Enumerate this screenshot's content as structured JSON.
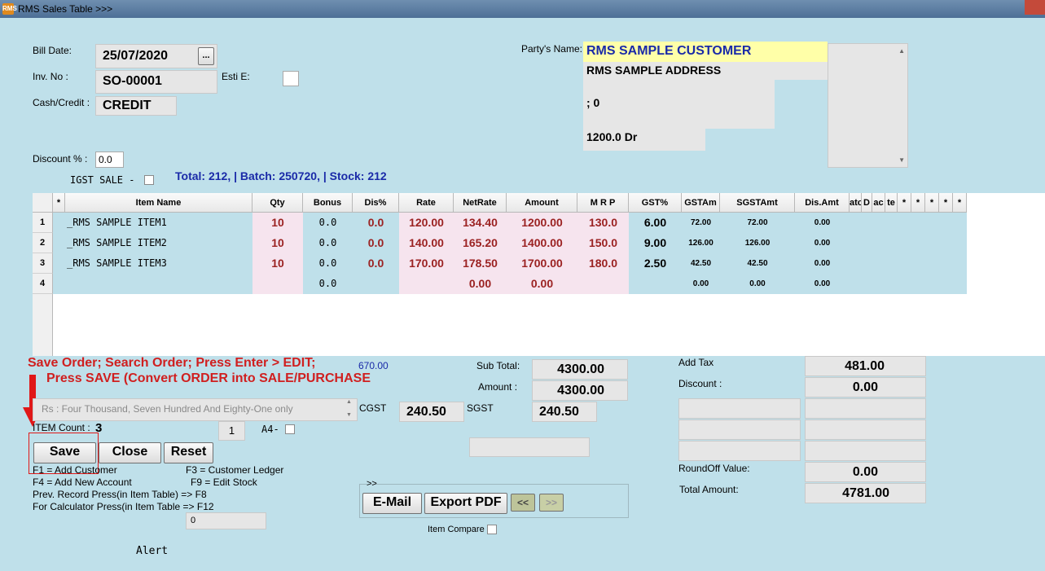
{
  "window": {
    "title": "RMS Sales Table >>>",
    "app_icon_text": "RMS"
  },
  "header": {
    "bill_date_label": "Bill Date:",
    "bill_date": "25/07/2020",
    "date_picker_label": "...",
    "inv_no_label": "Inv. No :",
    "inv_no": "SO-00001",
    "esti_label": "Esti E:",
    "cash_credit_label": "Cash/Credit :",
    "cash_credit": "CREDIT",
    "discount_label": "Discount % :",
    "discount_value": "0.0",
    "igst_label": "IGST SALE -",
    "totals_line": "Total: 212,  | Batch:  250720, | Stock: 212"
  },
  "party": {
    "label": "Party's Name:",
    "name": "RMS SAMPLE CUSTOMER",
    "address": "RMS SAMPLE ADDRESS",
    "line3": "; 0",
    "balance": "1200.0 Dr"
  },
  "grid": {
    "columns": [
      "*",
      "Item Name",
      "Qty",
      "Bonus",
      "Dis%",
      "Rate",
      "NetRate",
      "Amount",
      "M R P",
      "GST%",
      "GSTAm",
      "SGSTAmt",
      "Dis.Amt",
      "ato",
      "D",
      "ac",
      "te",
      "*",
      "*",
      "*",
      "*",
      "*"
    ],
    "rows": [
      {
        "num": "1",
        "item": "_RMS SAMPLE ITEM1",
        "qty": "10",
        "bonus": "0.0",
        "dis": "0.0",
        "rate": "120.00",
        "netrate": "134.40",
        "amount": "1200.00",
        "mrp": "130.0",
        "gst": "6.00",
        "cgst": "72.00",
        "sgst": "72.00",
        "disamt": "0.00"
      },
      {
        "num": "2",
        "item": "_RMS SAMPLE ITEM2",
        "qty": "10",
        "bonus": "0.0",
        "dis": "0.0",
        "rate": "140.00",
        "netrate": "165.20",
        "amount": "1400.00",
        "mrp": "150.0",
        "gst": "9.00",
        "cgst": "126.00",
        "sgst": "126.00",
        "disamt": "0.00"
      },
      {
        "num": "3",
        "item": "_RMS SAMPLE ITEM3",
        "qty": "10",
        "bonus": "0.0",
        "dis": "0.0",
        "rate": "170.00",
        "netrate": "178.50",
        "amount": "1700.00",
        "mrp": "180.0",
        "gst": "2.50",
        "cgst": "42.50",
        "sgst": "42.50",
        "disamt": "0.00"
      },
      {
        "num": "4",
        "item": "",
        "qty": "",
        "bonus": "0.0",
        "dis": "",
        "rate": "",
        "netrate": "0.00",
        "amount": "0.00",
        "mrp": "",
        "gst": "",
        "cgst": "0.00",
        "sgst": "0.00",
        "disamt": "0.00"
      }
    ]
  },
  "annotation": {
    "line1": "Save Order; Search Order; Press Enter > EDIT;",
    "line2": "Press SAVE (Convert ORDER into SALE/PURCHASE"
  },
  "footer": {
    "blue_value": "670.00",
    "amount_words": "Rs : Four Thousand, Seven Hundred And Eighty-One only",
    "item_count_label": "ITEM Count :",
    "item_count": "3",
    "copies": "1",
    "a4_label": "A4-",
    "save_label": "Save",
    "close_label": "Close",
    "reset_label": "Reset",
    "help": [
      "F1 = Add Customer",
      "F3 = Customer Ledger",
      "F4 = Add New Account",
      "F9 = Edit Stock",
      "Prev. Record Press(in Item Table)  => F8",
      "For Calculator Press(in Item Table => F12"
    ],
    "calc_value": "0",
    "alert_label": "Alert",
    "subtotal_label": "Sub Total:",
    "subtotal": "4300.00",
    "amount_label": "Amount :",
    "amount": "4300.00",
    "cgst_label": "CGST",
    "cgst": "240.50",
    "sgst_label": "SGST",
    "sgst": "240.50",
    "nav_label": ">>",
    "email_label": "E-Mail",
    "export_label": "Export PDF",
    "prev_label": "<<",
    "next_label": ">>",
    "item_compare_label": "Item Compare",
    "addtax_label": "Add Tax",
    "addtax": "481.00",
    "discount_label": "Discount :",
    "discount": "0.00",
    "roundoff_label": "RoundOff Value:",
    "roundoff": "0.00",
    "total_label": "Total Amount:",
    "total": "4781.00"
  },
  "colors": {
    "background": "#bfe0ea",
    "annotation": "#d01f1f",
    "highlight_name": "#ffffa8",
    "blue_text": "#1a2aa8"
  }
}
